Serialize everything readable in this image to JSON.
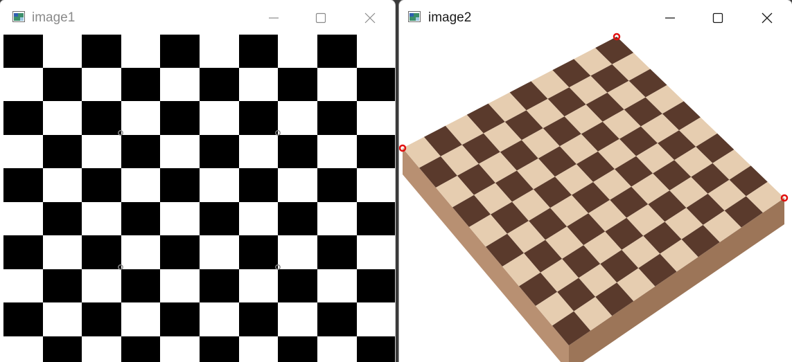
{
  "windows": [
    {
      "title": "image1",
      "focused": false,
      "controls": [
        "minimize-icon",
        "maximize-icon",
        "close-icon"
      ],
      "content": {
        "kind": "black-and-white checkerboard",
        "colors": [
          "#000000",
          "#ffffff"
        ]
      }
    },
    {
      "title": "image2",
      "focused": true,
      "controls": [
        "minimize-icon",
        "maximize-icon",
        "close-icon"
      ],
      "content": {
        "kind": "wooden chessboard photo",
        "colors": [
          "#5a3a2c",
          "#e6cdb0"
        ],
        "marker_color": "#e01010"
      }
    }
  ]
}
